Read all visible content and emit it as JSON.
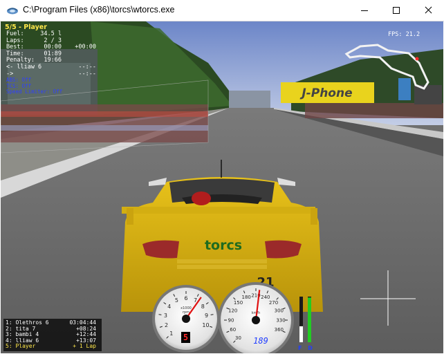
{
  "window": {
    "title": "C:\\Program Files (x86)\\torcs\\wtorcs.exe"
  },
  "hud": {
    "header": "5/5 - Player",
    "rows": [
      {
        "label": "Fuel:",
        "value": "34.5 l",
        "extra": ""
      },
      {
        "label": "Laps:",
        "value": "2 / 3",
        "extra": ""
      },
      {
        "label": "Best:",
        "value": "00:00",
        "extra": "+00:00"
      },
      {
        "label": "Time:",
        "value": "01:89",
        "extra": ""
      },
      {
        "label": "Penalty:",
        "value": "19:66",
        "extra": ""
      },
      {
        "label": "<- lliaw 6",
        "value": "",
        "extra": "--:--"
      },
      {
        "label": "->",
        "value": "",
        "extra": "--:--"
      }
    ],
    "blue_lines": [
      "ABS: Off",
      "TCS: Off",
      "Speed Limiter: Off"
    ],
    "fps": "FPS: 21.2"
  },
  "standings": [
    {
      "name": "1: Olethros 6",
      "gap": "03:04:44"
    },
    {
      "name": "2: tita 7",
      "gap": "+08:24"
    },
    {
      "name": "3: bambi 4",
      "gap": "+12:44"
    },
    {
      "name": "4: lliaw 6",
      "gap": "+13:07"
    },
    {
      "name": "5: Player",
      "gap": "+ 1 Lap"
    }
  ],
  "scene": {
    "banner_text": "J-Phone",
    "car_text": "torcs",
    "car_number": "21"
  },
  "tachometer": {
    "unit_line1": "x1000",
    "unit_line2": "rpm",
    "ticks": [
      "1",
      "2",
      "3",
      "4",
      "5",
      "6",
      "7",
      "8",
      "9",
      "10"
    ],
    "value": 6.3,
    "max": 10,
    "gear": "5"
  },
  "speedometer": {
    "unit": "km/h",
    "ticks": [
      "30",
      "60",
      "90",
      "120",
      "150",
      "180",
      "210",
      "240",
      "270",
      "300",
      "330",
      "360"
    ],
    "value": 189,
    "max": 360,
    "digital": "189"
  },
  "pedals": {
    "labels": "F D",
    "fuel_fraction": 0.35,
    "damage_fraction": 0.98
  },
  "colors": {
    "car_yellow": "#e8c21a",
    "hud_yellow": "#ffe84a",
    "hud_blue": "#2f40ff",
    "gear_red": "#ff2a2a",
    "fuel_bar": "#ffffff",
    "damage_bar": "#22cc22"
  }
}
